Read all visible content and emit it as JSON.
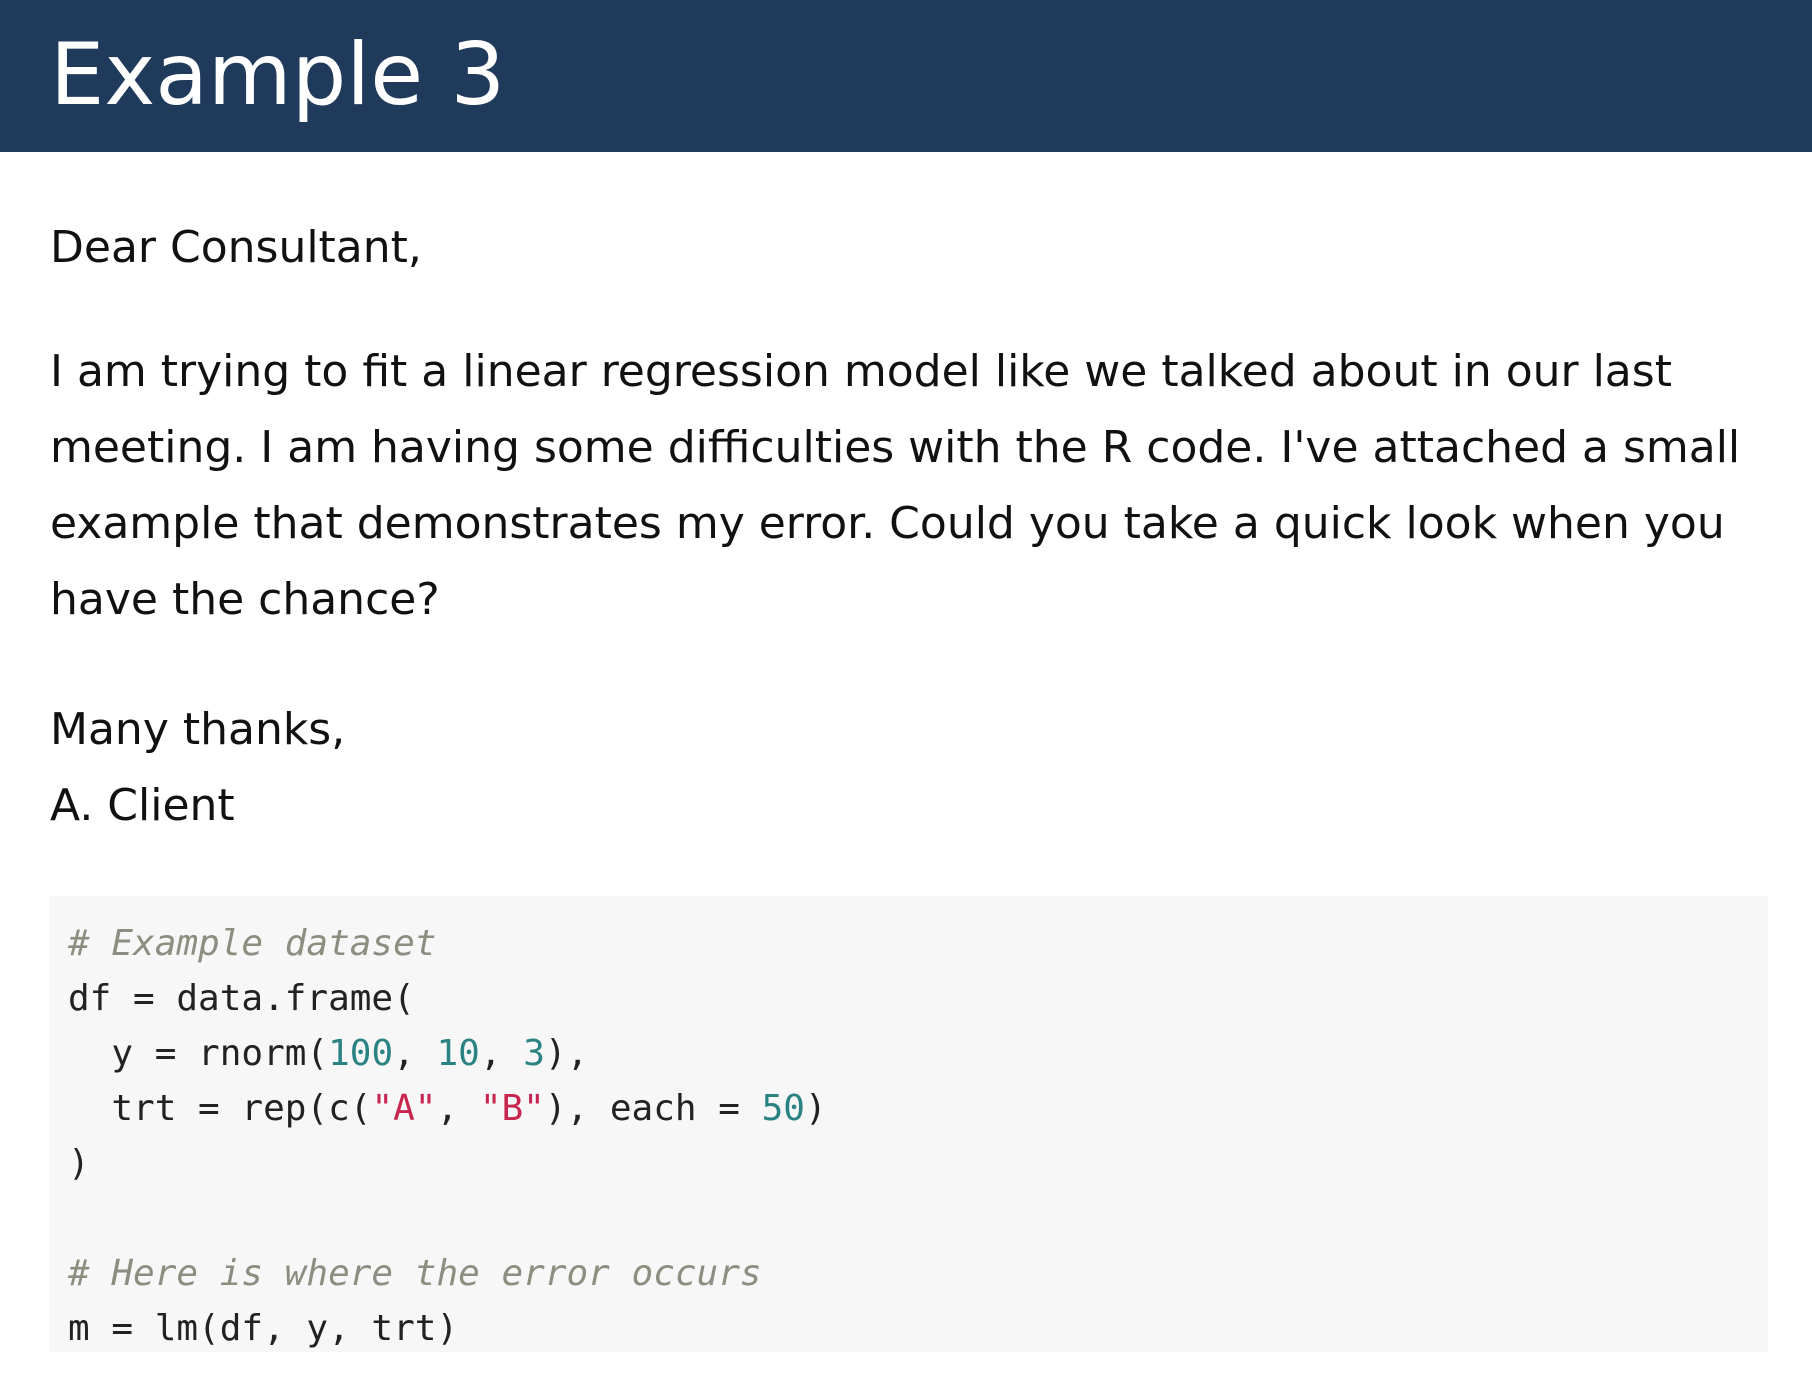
{
  "header": {
    "title": "Example 3",
    "background": "#1f3a5a"
  },
  "letter": {
    "greeting": "Dear Consultant,",
    "body_lines": [
      "I am trying to fit a linear regression model like we talked about in our last",
      "meeting. I am having some difficulties with the R code. I've attached a small",
      "example that demonstrates my error. Could you take a quick look when you",
      "have the chance?"
    ],
    "signoff": "Many thanks,",
    "signature": "A. Client"
  },
  "code": {
    "comment1": "# Example dataset",
    "l2a": "df = data.frame(",
    "l3a": "  y = rnorm(",
    "l3n1": "100",
    "l3s1": ", ",
    "l3n2": "10",
    "l3s2": ", ",
    "l3n3": "3",
    "l3b": "),",
    "l4a": "  trt = rep(c(",
    "l4s1": "\"A\"",
    "l4b": ", ",
    "l4s2": "\"B\"",
    "l4c": "), each = ",
    "l4n1": "50",
    "l4d": ")",
    "l5": ")",
    "comment2": "# Here is where the error occurs",
    "l8": "m = lm(df, y, trt)",
    "colors": {
      "comment": "#8d8d80",
      "number": "#2b8282",
      "string": "#c7254e",
      "background": "#f7f7f7"
    }
  }
}
